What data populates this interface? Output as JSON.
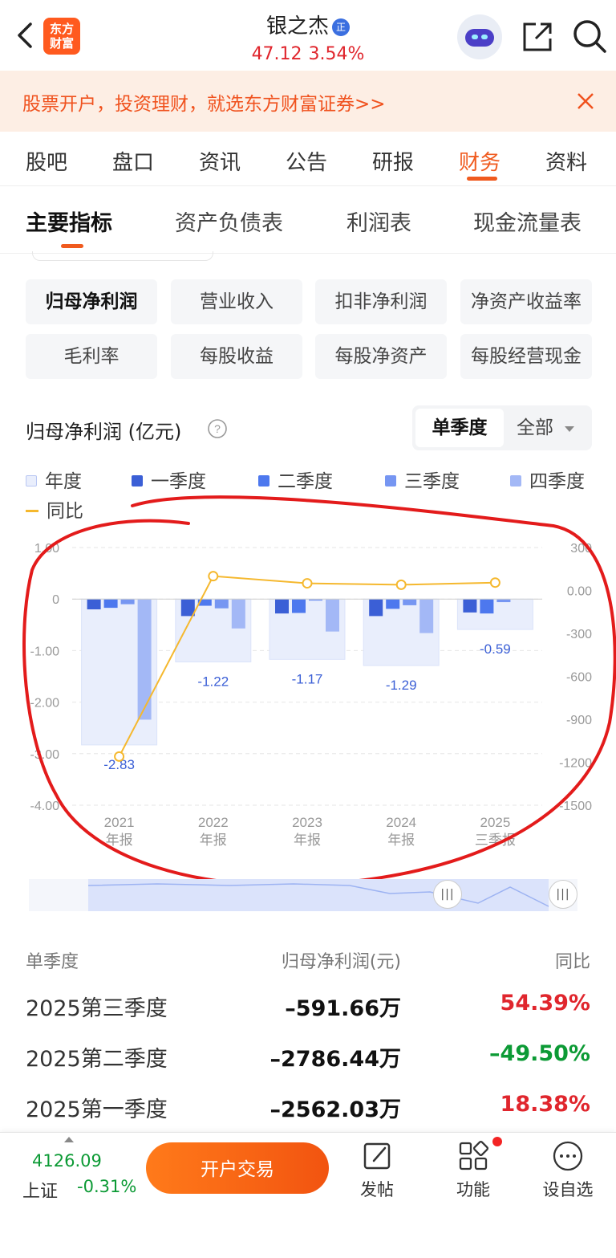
{
  "header": {
    "stock_name": "银之杰",
    "badge": "正",
    "logo_text": "东方财富",
    "price": "47.12",
    "change_pct": "3.54%"
  },
  "banner": {
    "text": "股票开户，投资理财，就选东方财富证券>>"
  },
  "tabs": [
    {
      "label": "股吧"
    },
    {
      "label": "盘口"
    },
    {
      "label": "资讯"
    },
    {
      "label": "公告"
    },
    {
      "label": "研报"
    },
    {
      "label": "财务",
      "active": true
    },
    {
      "label": "资料"
    }
  ],
  "subtabs": [
    {
      "label": "主要指标",
      "active": true
    },
    {
      "label": "资产负债表"
    },
    {
      "label": "利润表"
    },
    {
      "label": "现金流量表"
    }
  ],
  "chips": [
    {
      "label": "归母净利润",
      "active": true
    },
    {
      "label": "营业收入"
    },
    {
      "label": "扣非净利润"
    },
    {
      "label": "净资产收益率"
    },
    {
      "label": "毛利率"
    },
    {
      "label": "每股收益"
    },
    {
      "label": "每股净资产"
    },
    {
      "label": "每股经营现金"
    }
  ],
  "chart_header": {
    "title": "归母净利润 (亿元)",
    "segment_active": "单季度",
    "segment_other": "全部"
  },
  "legend": [
    {
      "label": "年度",
      "color": "#e9eefc"
    },
    {
      "label": "一季度",
      "color": "#3b5fd6"
    },
    {
      "label": "二季度",
      "color": "#4d78ee"
    },
    {
      "label": "三季度",
      "color": "#7696f2"
    },
    {
      "label": "四季度",
      "color": "#a3b8f6"
    },
    {
      "label": "同比",
      "color": "#f5b82e"
    }
  ],
  "chart_data": {
    "type": "bar",
    "categories": [
      {
        "year": "2021",
        "period": "年报"
      },
      {
        "year": "2022",
        "period": "年报"
      },
      {
        "year": "2023",
        "period": "年报"
      },
      {
        "year": "2024",
        "period": "年报"
      },
      {
        "year": "2025",
        "period": "三季报"
      }
    ],
    "annual": [
      -2.83,
      -1.22,
      -1.17,
      -1.29,
      -0.59
    ],
    "annual_labels": [
      "-2.83",
      "-1.22",
      "-1.17",
      "-1.29",
      "-0.59"
    ],
    "series": [
      {
        "name": "一季度",
        "values": [
          -0.2,
          -0.33,
          -0.28,
          -0.33,
          -0.26
        ]
      },
      {
        "name": "二季度",
        "values": [
          -0.17,
          -0.13,
          -0.27,
          -0.19,
          -0.28
        ]
      },
      {
        "name": "三季度",
        "values": [
          -0.1,
          -0.18,
          -0.03,
          -0.12,
          -0.06
        ]
      },
      {
        "name": "四季度",
        "values": [
          -2.34,
          -0.57,
          -0.63,
          -0.66,
          null
        ]
      }
    ],
    "yoy": [
      -1160,
      100,
      50,
      40,
      55
    ],
    "ylim_left": [
      -4.0,
      1.0
    ],
    "ylim_right": [
      -1500,
      300
    ],
    "left_ticks": [
      "1.00",
      "0",
      "-1.00",
      "-2.00",
      "-3.00",
      "-4.00"
    ],
    "left_tick_values": [
      1,
      0,
      -1,
      -2,
      -3,
      -4
    ],
    "right_ticks": [
      "300",
      "0.00",
      "-300",
      "-600",
      "-900",
      "-1200",
      "-1500"
    ],
    "right_tick_values": [
      300,
      0,
      -300,
      -600,
      -900,
      -1200,
      -1500
    ],
    "grid": true,
    "legend": "top"
  },
  "table": {
    "headers": [
      "单季度",
      "归母净利润(元)",
      "同比"
    ],
    "rows": [
      {
        "period": "2025第三季度",
        "value": "–591.66万",
        "yoy": "54.39%",
        "dir": "up"
      },
      {
        "period": "2025第二季度",
        "value": "–2786.44万",
        "yoy": "–49.50%",
        "dir": "down"
      },
      {
        "period": "2025第一季度",
        "value": "–2562.03万",
        "yoy": "18.38%",
        "dir": "up"
      }
    ]
  },
  "bottom": {
    "index_value": "4126.09",
    "index_name": "上证",
    "index_change": "-0.31%",
    "open_button": "开户交易",
    "items": [
      {
        "label": "发帖",
        "icon": "edit-icon"
      },
      {
        "label": "功能",
        "icon": "grid-icon"
      },
      {
        "label": "设自选",
        "icon": "more-icon"
      }
    ]
  }
}
